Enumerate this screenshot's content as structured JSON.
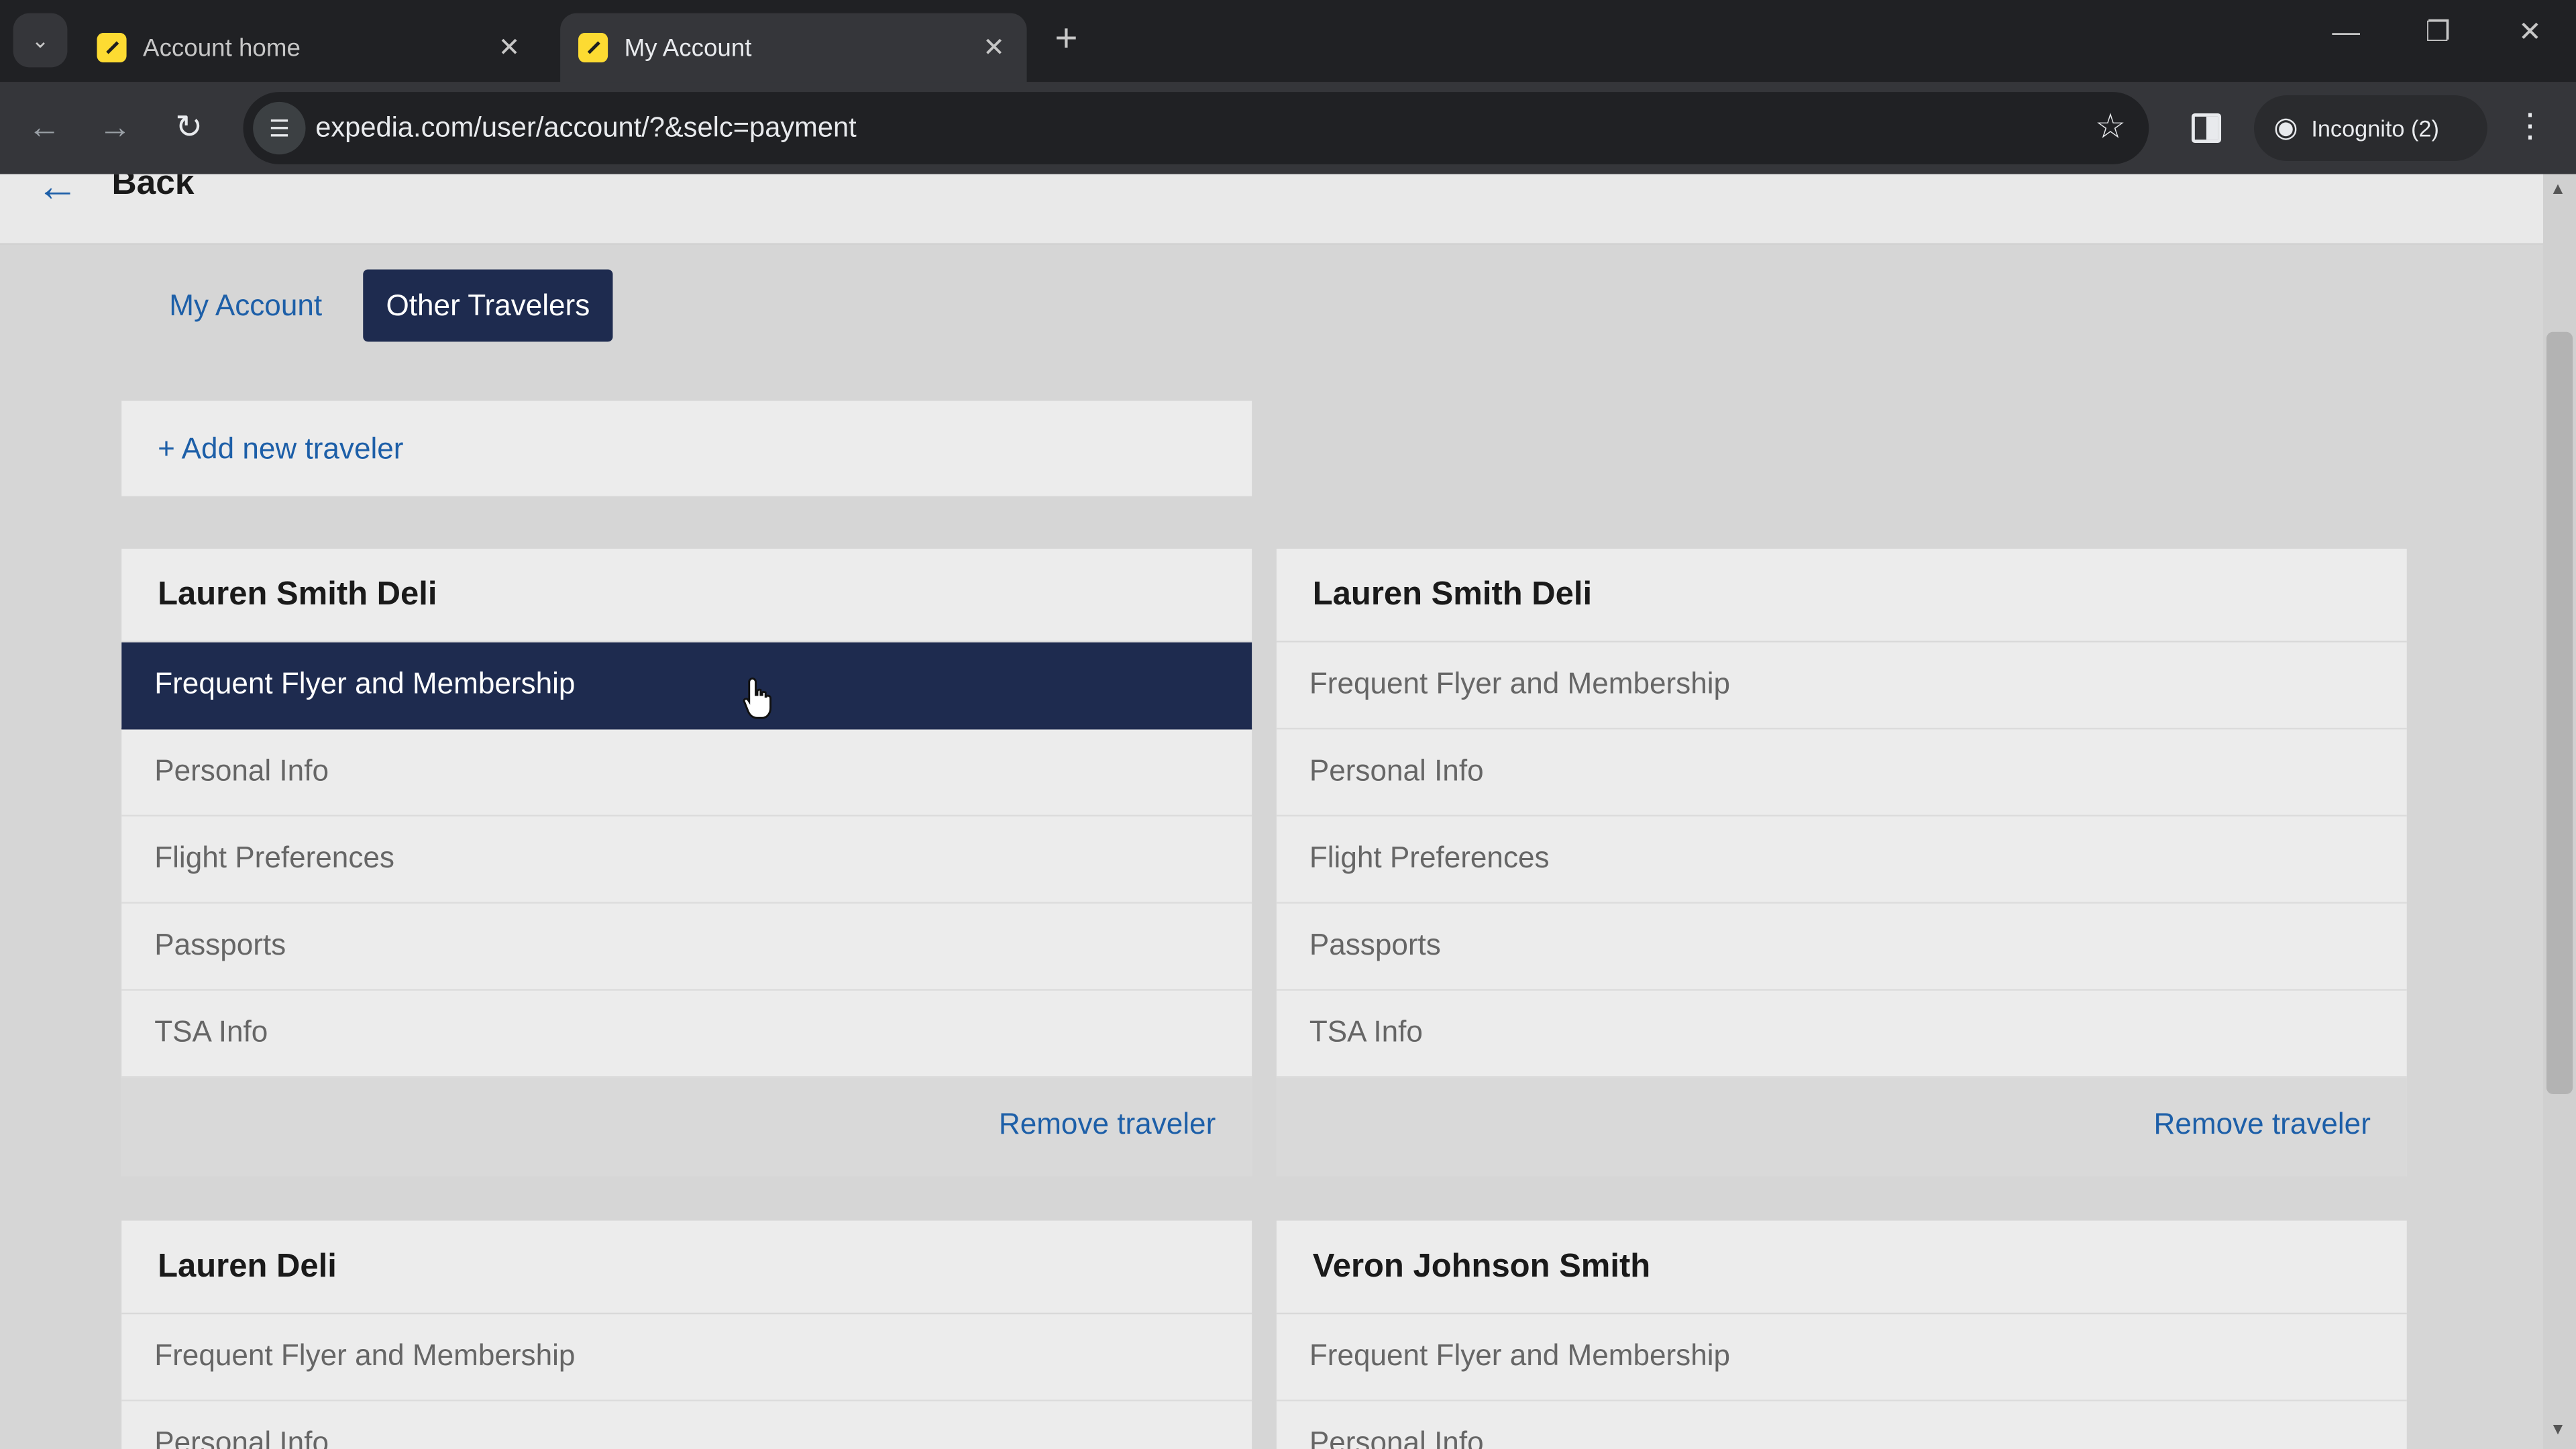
{
  "browser": {
    "tabs": [
      {
        "title": "Account home",
        "active": false
      },
      {
        "title": "My Account",
        "active": true
      }
    ],
    "url": "expedia.com/user/account/?&selc=payment",
    "incognito_label": "Incognito (2)"
  },
  "page": {
    "back_label": "Back",
    "segments": {
      "my_account": "My Account",
      "other_travelers": "Other Travelers",
      "selected": "Other Travelers"
    },
    "add_traveler": "+ Add new traveler",
    "travelers": [
      {
        "name": "Lauren Smith Deli",
        "items": [
          "Frequent Flyer and Membership",
          "Personal Info",
          "Flight Preferences",
          "Passports",
          "TSA Info"
        ],
        "remove": "Remove traveler"
      },
      {
        "name": "Lauren Smith Deli",
        "items": [
          "Frequent Flyer and Membership",
          "Personal Info",
          "Flight Preferences",
          "Passports",
          "TSA Info"
        ],
        "remove": "Remove traveler"
      },
      {
        "name": "Lauren Deli",
        "items": [
          "Frequent Flyer and Membership",
          "Personal Info"
        ]
      },
      {
        "name": "Veron Johnson Smith",
        "items": [
          "Frequent Flyer and Membership",
          "Personal Info"
        ]
      }
    ]
  },
  "colors": {
    "accent_dark": "#1e2b4f",
    "link_blue": "#1d5fa8",
    "expedia_yellow": "#fddb32"
  }
}
